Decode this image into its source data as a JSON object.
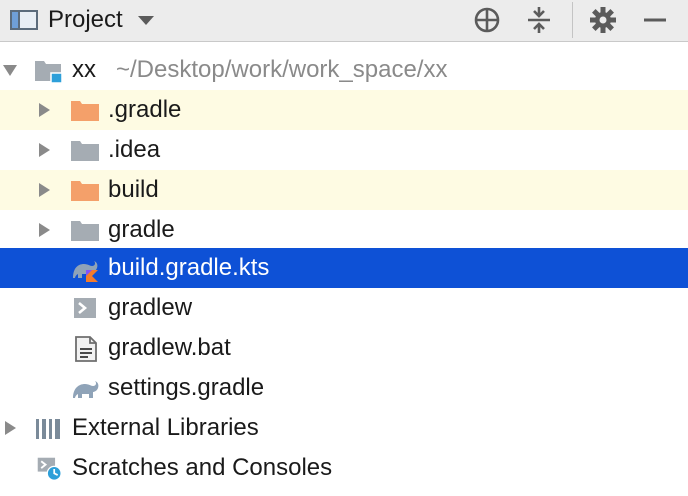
{
  "toolbar": {
    "view_label": "Project",
    "icons": [
      "project-view-icon",
      "dropdown-caret-icon",
      "locate-icon",
      "collapse-all-icon",
      "gear-icon",
      "minimize-icon"
    ]
  },
  "tree": {
    "root": {
      "name": "xx",
      "path": "~/Desktop/work/work_space/xx"
    },
    "children": [
      {
        "name": ".gradle",
        "type": "folder-excluded"
      },
      {
        "name": ".idea",
        "type": "folder"
      },
      {
        "name": "build",
        "type": "folder-excluded"
      },
      {
        "name": "gradle",
        "type": "folder"
      },
      {
        "name": "build.gradle.kts",
        "type": "gradle-kts-file",
        "selected": true
      },
      {
        "name": "gradlew",
        "type": "shell-file"
      },
      {
        "name": "gradlew.bat",
        "type": "text-file"
      },
      {
        "name": "settings.gradle",
        "type": "gradle-file"
      }
    ],
    "external_libraries": "External Libraries",
    "scratches": "Scratches and Consoles"
  },
  "colors": {
    "selection": "#0e51d6",
    "excluded_row": "#fefbe3",
    "excluded_folder": "#f4a06a",
    "folder": "#a5acb3",
    "toolbar_bg": "#ececec"
  }
}
